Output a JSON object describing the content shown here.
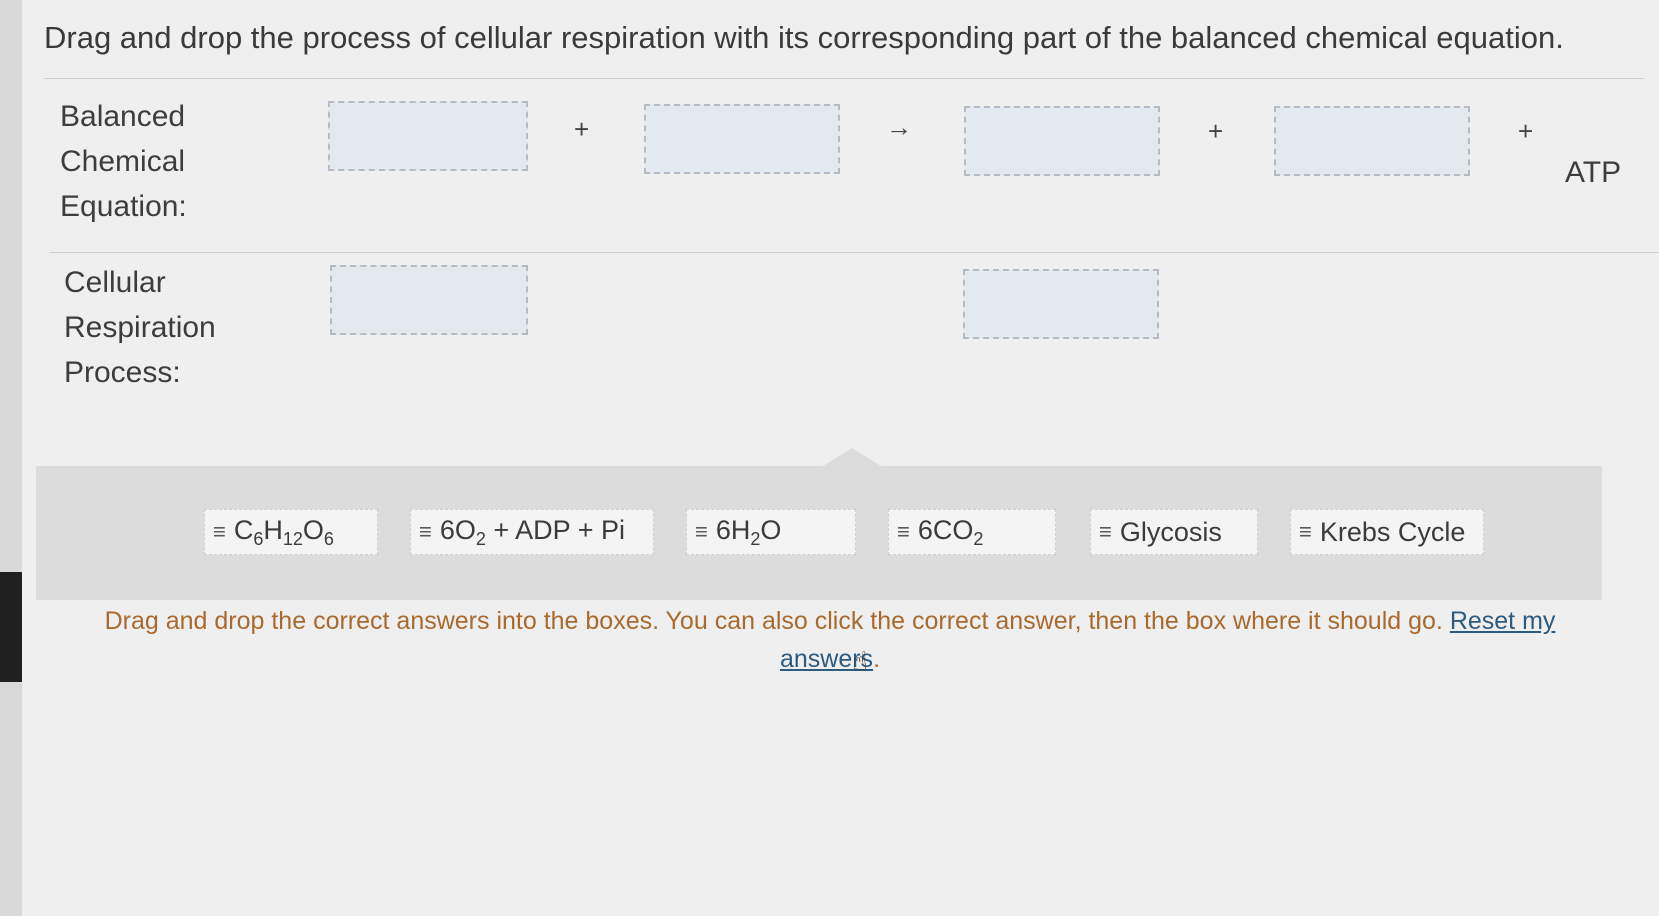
{
  "prompt": "Drag and drop the process of cellular respiration with its corresponding part of the balanced chemical equation.",
  "rows": {
    "equation_label": [
      "Balanced",
      "Chemical",
      "Equation:"
    ],
    "process_label": [
      "Cellular",
      "Respiration",
      "Process:"
    ]
  },
  "equation": {
    "plus": "+",
    "arrow": "→",
    "atp": "ATP"
  },
  "tiles": [
    {
      "grip": "≡",
      "parts": [
        [
          "C",
          ""
        ],
        [
          "6",
          "sub"
        ],
        [
          "H",
          ""
        ],
        [
          "12",
          "sub"
        ],
        [
          "O",
          ""
        ],
        [
          "6",
          "sub"
        ]
      ]
    },
    {
      "grip": "≡",
      "parts": [
        [
          "6O",
          ""
        ],
        [
          "2",
          "sub"
        ],
        [
          " + ADP + Pi",
          ""
        ]
      ]
    },
    {
      "grip": "≡",
      "parts": [
        [
          "6H",
          ""
        ],
        [
          "2",
          "sub"
        ],
        [
          "O",
          ""
        ]
      ]
    },
    {
      "grip": "≡",
      "parts": [
        [
          "6CO",
          ""
        ],
        [
          "2",
          "sub"
        ]
      ]
    },
    {
      "grip": "≡",
      "parts": [
        [
          "Glycosis",
          ""
        ]
      ]
    },
    {
      "grip": "≡",
      "parts": [
        [
          "Krebs Cycle",
          ""
        ]
      ]
    }
  ],
  "instructions": {
    "text": "Drag and drop the correct answers into the boxes. You can also click the correct answer, then the box where it should go. ",
    "reset_link": "Reset my answers",
    "period": "."
  }
}
